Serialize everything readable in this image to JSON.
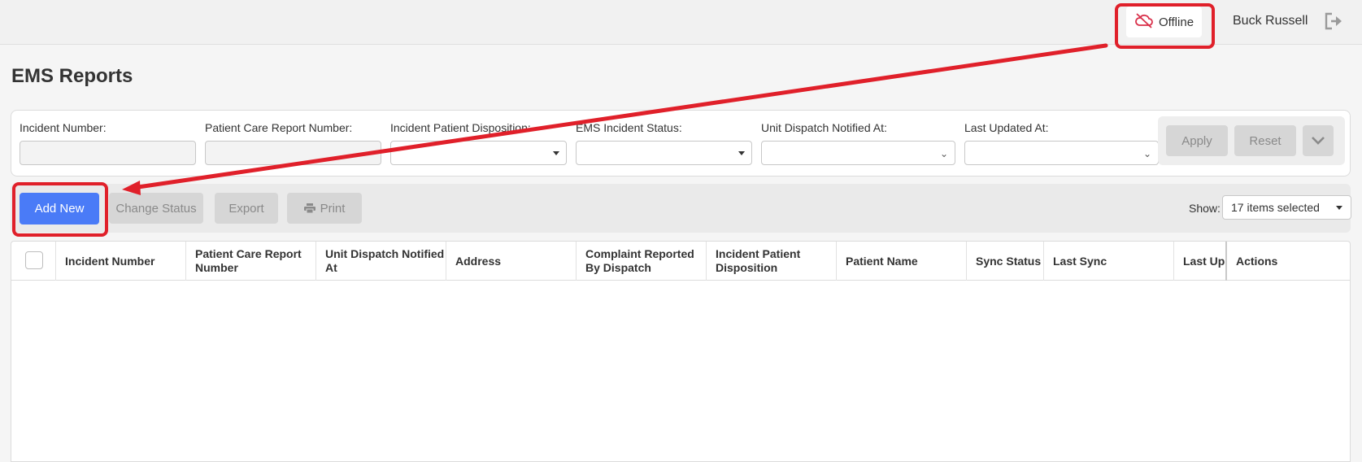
{
  "header": {
    "status_label": "Offline",
    "user_name": "Buck Russell",
    "status_icon": "cloud-offline-icon",
    "logout_icon": "logout-icon"
  },
  "page": {
    "title": "EMS Reports"
  },
  "filters": {
    "incident_number": {
      "label": "Incident Number:",
      "value": ""
    },
    "pcr_number": {
      "label": "Patient Care Report Number:",
      "value": ""
    },
    "disposition": {
      "label": "Incident Patient Disposition:",
      "value": ""
    },
    "ems_status": {
      "label": "EMS Incident Status:",
      "value": ""
    },
    "unit_dispatch": {
      "label": "Unit Dispatch Notified At:",
      "value": ""
    },
    "last_updated": {
      "label": "Last Updated At:",
      "value": ""
    },
    "apply_label": "Apply",
    "reset_label": "Reset"
  },
  "toolbar": {
    "add_new_label": "Add New",
    "change_status_label": "Change Status",
    "export_label": "Export",
    "print_label": "Print",
    "show_label": "Show:",
    "show_value": "17 items selected"
  },
  "grid": {
    "columns": [
      "Incident Number",
      "Patient Care Report Number",
      "Unit Dispatch Notified At",
      "Address",
      "Complaint Reported By Dispatch",
      "Incident Patient Disposition",
      "Patient Name",
      "Sync Status",
      "Last Sync",
      "Last Upd",
      "Actions"
    ],
    "rows": []
  },
  "colors": {
    "primary": "#4a7bf7",
    "annotation": "#e0202a",
    "offline_icon": "#d9304a"
  }
}
